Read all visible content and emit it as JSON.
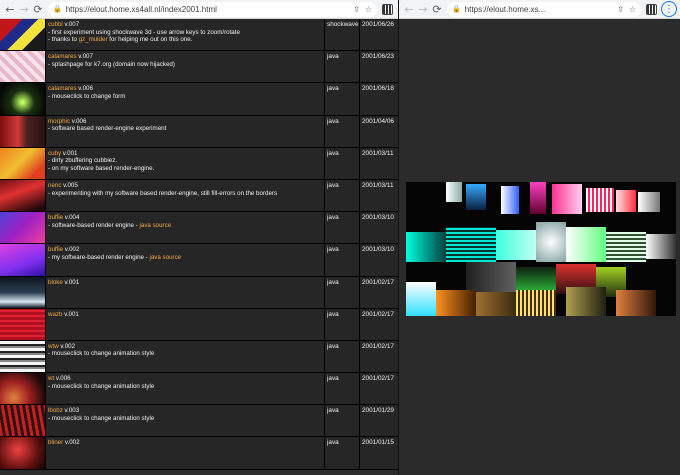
{
  "left_window": {
    "url": "https://elout.home.xs4all.nl/index2001.html",
    "entries": [
      {
        "name": "cubbi",
        "version": " v.007",
        "lines": [
          [
            "- first experiment using shockwave 3d - use arrow keys to zoom/rotate"
          ],
          [
            "- thanks to ",
            {
              "link": "gz_mulder"
            },
            " for helping me out on this one."
          ]
        ],
        "tech": "shockwave",
        "date": "2001/06/26"
      },
      {
        "name": "calamares",
        "version": " v.007",
        "lines": [
          [
            "- splashpage for k7.org (domain now hijacked)"
          ]
        ],
        "tech": "java",
        "date": "2001/06/23"
      },
      {
        "name": "calamares",
        "version": " v.006",
        "lines": [
          [
            "- mouseclick to change form"
          ]
        ],
        "tech": "java",
        "date": "2001/06/18"
      },
      {
        "name": "morphic",
        "version": " v.006",
        "lines": [
          [
            "- software based render-engine experiment"
          ]
        ],
        "tech": "java",
        "date": "2001/04/06"
      },
      {
        "name": "cuby",
        "version": " v.001",
        "lines": [
          [
            "- dirty zbuffering cubbiez."
          ],
          [
            "- on my software based render-engine."
          ]
        ],
        "tech": "java",
        "date": "2001/03/11"
      },
      {
        "name": "nenc",
        "version": " v.005",
        "lines": [
          [
            "- experimenting with my software based render-engine, still fill-errors on the borders"
          ]
        ],
        "tech": "java",
        "date": "2001/03/11"
      },
      {
        "name": "buffie",
        "version": " v.004",
        "lines": [
          [
            "- software-based render engine - ",
            {
              "link": "java source"
            }
          ]
        ],
        "tech": "java",
        "date": "2001/03/10"
      },
      {
        "name": "buffie",
        "version": " v.002",
        "lines": [
          [
            "- my software-based render engine - ",
            {
              "link": "java source"
            }
          ]
        ],
        "tech": "java",
        "date": "2001/03/10"
      },
      {
        "name": "bloke",
        "version": " v.001",
        "lines": [],
        "tech": "java",
        "date": "2001/02/17"
      },
      {
        "name": "wazb",
        "version": " v.001",
        "lines": [],
        "tech": "java",
        "date": "2001/02/17"
      },
      {
        "name": "wtw",
        "version": " v.002",
        "lines": [
          [
            "- mouseclick to change animation style"
          ]
        ],
        "tech": "java",
        "date": "2001/02/17"
      },
      {
        "name": "wt",
        "version": " v.006",
        "lines": [
          [
            "- mouseclick to change animation style"
          ]
        ],
        "tech": "java",
        "date": "2001/02/17"
      },
      {
        "name": "lbobz",
        "version": " v.003",
        "lines": [
          [
            "- mouseclick to change animation style"
          ]
        ],
        "tech": "java",
        "date": "2001/01/29"
      },
      {
        "name": "bliner",
        "version": " v.002",
        "lines": [],
        "tech": "java",
        "date": "2001/01/15"
      }
    ]
  },
  "right_window": {
    "url": "https://elout.home.xs..."
  },
  "icons": {
    "back": "←",
    "forward": "→",
    "reload": "⟳",
    "lock": "🔒",
    "share": "⇪",
    "star": "☆",
    "menu": "⋮"
  }
}
